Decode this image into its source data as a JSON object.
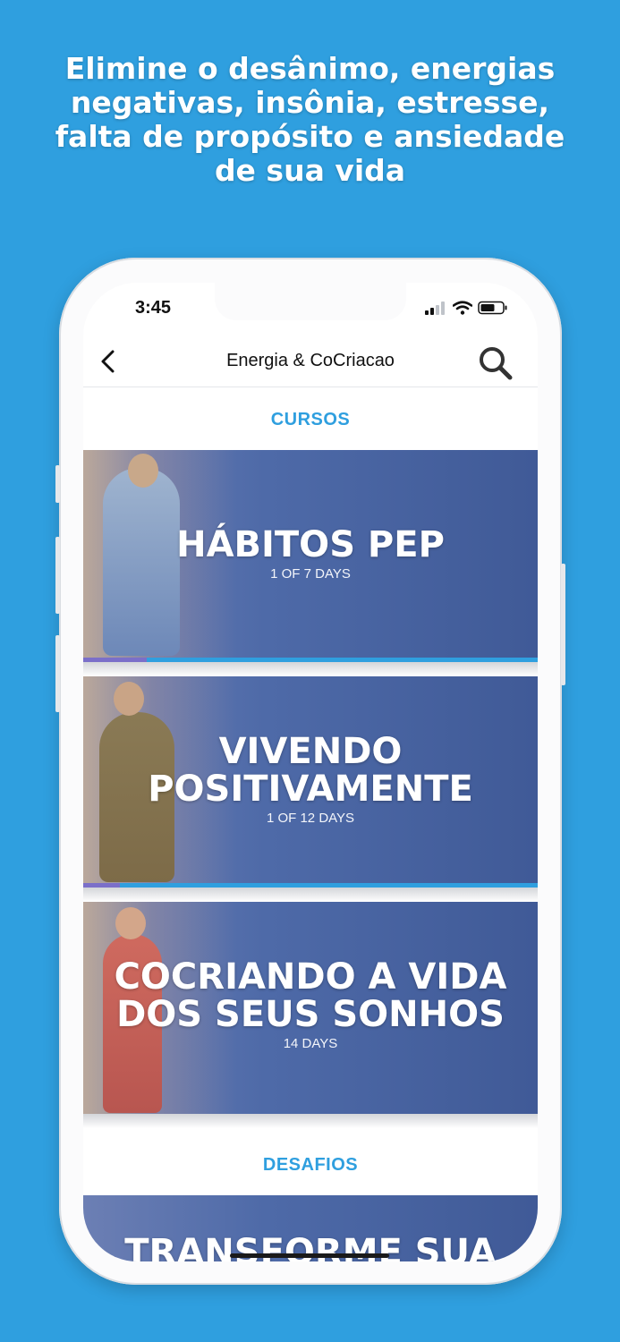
{
  "headline": "Elimine o  desânimo, energias negativas, insônia, estresse, falta de propósito e ansiedade de sua vida",
  "status_bar": {
    "time": "3:45"
  },
  "navbar": {
    "title": "Energia & CoCriacao",
    "back_icon": "chevron-left-icon",
    "search_icon": "search-icon"
  },
  "sections": {
    "courses_title": "CURSOS",
    "challenges_title": "DESAFIOS"
  },
  "courses": [
    {
      "title_line1": "HÁBITOS PEP",
      "title_line2": "",
      "subtitle": "1 OF 7 DAYS",
      "progress": 0.14
    },
    {
      "title_line1": "VIVENDO",
      "title_line2": "POSITIVAMENTE",
      "subtitle": "1 OF 12 DAYS",
      "progress": 0.08
    },
    {
      "title_line1": "COCRIANDO A VIDA",
      "title_line2": "DOS SEUS SONHOS",
      "subtitle": "14 DAYS"
    }
  ],
  "challenges": [
    {
      "title_line1": "TRANSFORME SUA"
    }
  ],
  "colors": {
    "background": "#2f9fdf",
    "accent": "#2f9fdf",
    "progress_fill": "#7b6fc9"
  }
}
